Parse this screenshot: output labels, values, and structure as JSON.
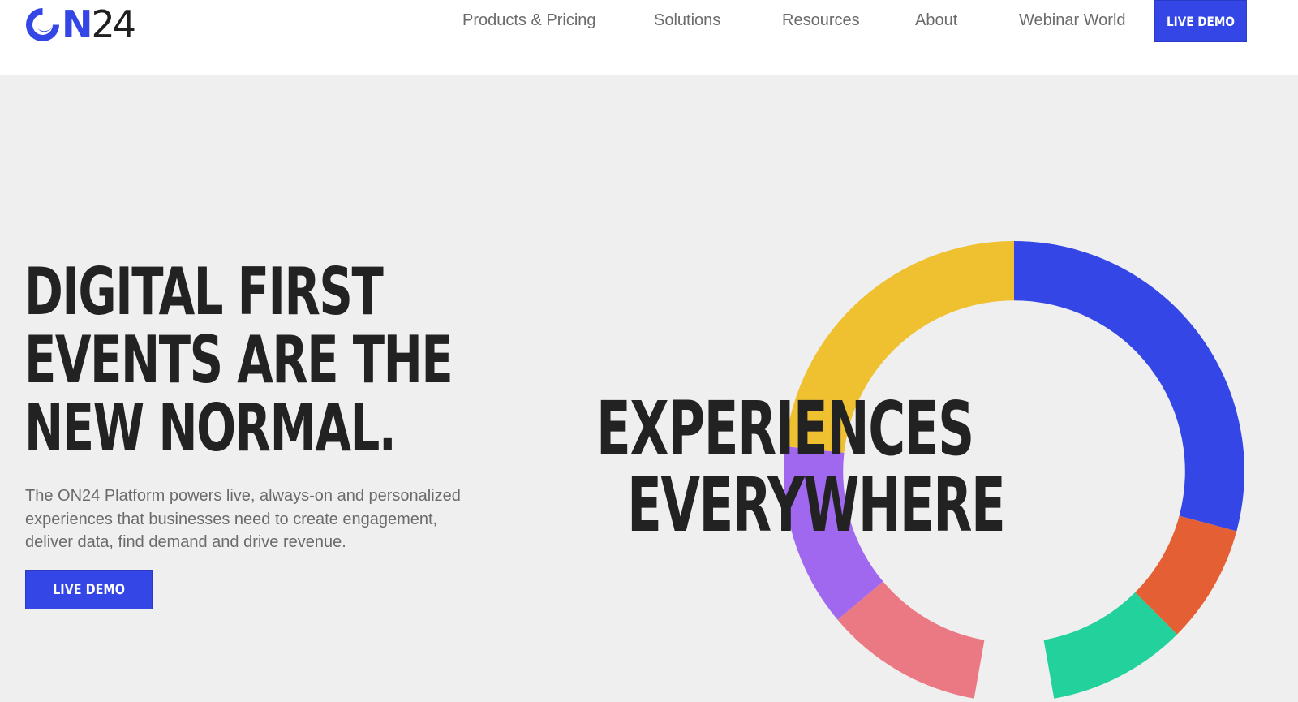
{
  "header": {
    "logo": {
      "letter_o_icon": "on24-o-logo-icon",
      "letter": "N",
      "number": "24"
    },
    "nav": [
      {
        "label": "Products & Pricing"
      },
      {
        "label": "Solutions"
      },
      {
        "label": "Resources"
      },
      {
        "label": "About"
      },
      {
        "label": "Webinar World"
      }
    ],
    "cta_label": "LIVE DEMO"
  },
  "hero": {
    "title_lines": [
      "DIGITAL FIRST",
      "EVENTS ARE THE",
      "NEW NORMAL."
    ],
    "subtitle": "The ON24 Platform powers live, always-on and personalized experiences that businesses need to create engagement, deliver data, find demand and drive revenue.",
    "cta_label": "LIVE DEMO"
  },
  "visual": {
    "headline_lines": [
      "EXPERIENCES",
      "EVERYWHERE"
    ]
  },
  "colors": {
    "brand_blue": "#3447e6",
    "yellow": "#efc030",
    "orange": "#e45f33",
    "green": "#22d19b",
    "pink": "#ea7984",
    "purple": "#a068ef",
    "background": "#efefef",
    "text_dark": "#222222",
    "text_muted": "#6b6b6b"
  }
}
